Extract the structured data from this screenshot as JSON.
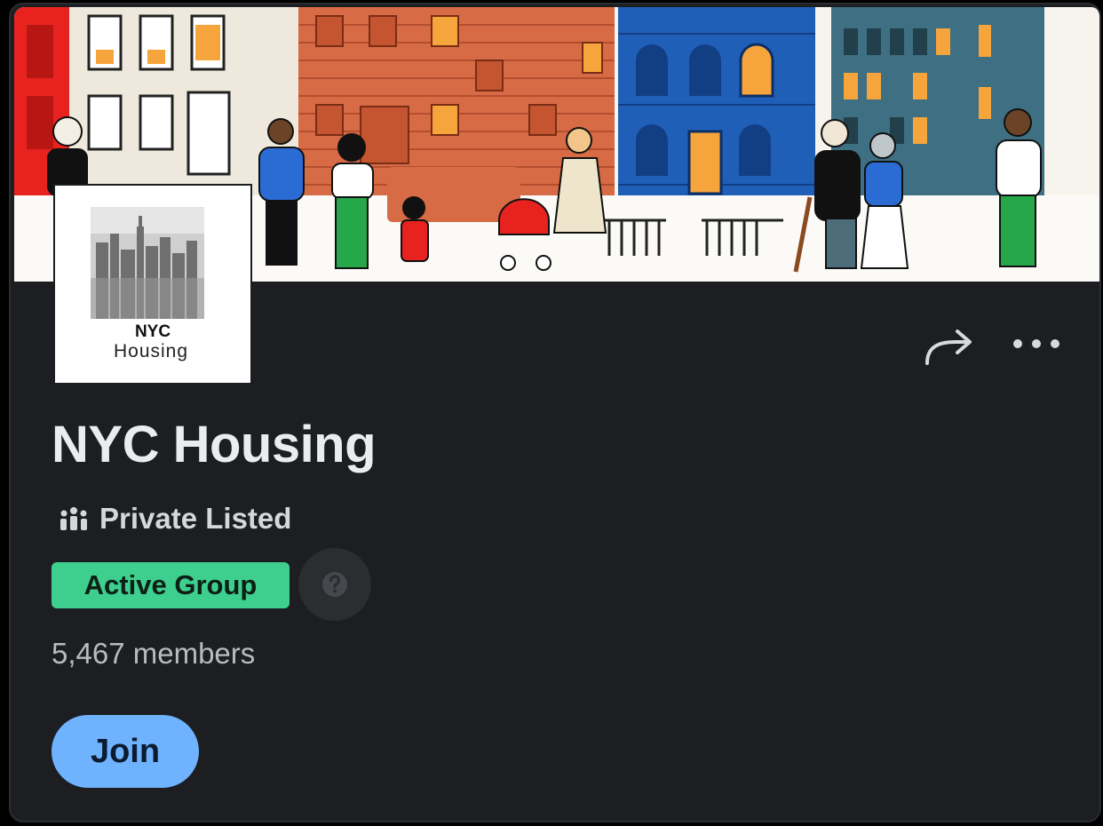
{
  "group": {
    "name": "NYC Housing",
    "privacy": "Private Listed",
    "status_badge": "Active Group",
    "members": "5,467 members"
  },
  "avatar": {
    "logo_line1": "NYC",
    "logo_line2": "Housing"
  },
  "actions": {
    "join_label": "Join",
    "share_icon": "share-arrow-icon",
    "more_icon": "ellipsis-icon",
    "help_icon": "question-icon"
  },
  "colors": {
    "card_background": "#1c1e22",
    "badge_green": "#3ecf8e",
    "join_blue": "#6fb3ff",
    "title_text": "#ebecef"
  }
}
